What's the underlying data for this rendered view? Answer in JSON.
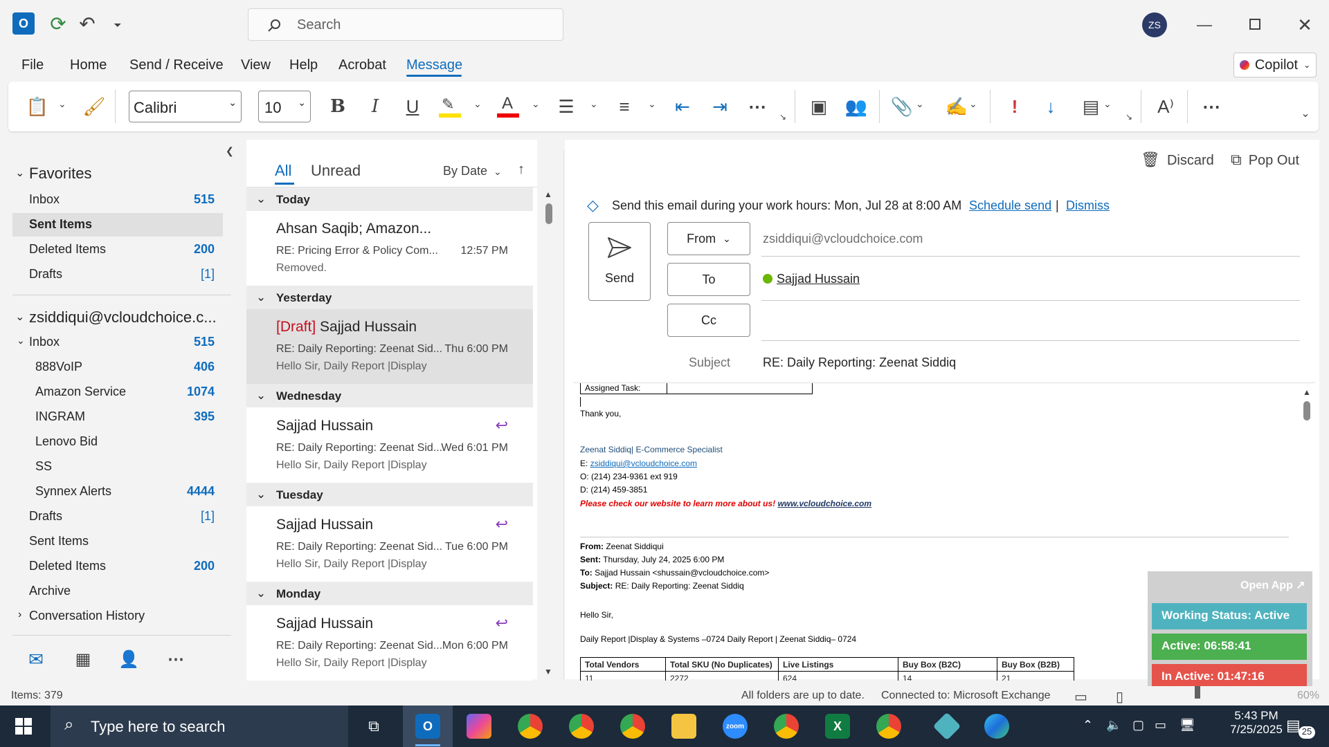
{
  "titlebar": {
    "search_placeholder": "Search",
    "avatar_initials": "ZS"
  },
  "menu": {
    "items": [
      "File",
      "Home",
      "Send / Receive",
      "View",
      "Help",
      "Acrobat",
      "Message"
    ],
    "copilot": "Copilot"
  },
  "ribbon": {
    "font_name": "Calibri",
    "font_size": "10"
  },
  "nav": {
    "favorites_label": "Favorites",
    "favorites": [
      {
        "label": "Inbox",
        "count": "515"
      },
      {
        "label": "Sent Items",
        "count": ""
      },
      {
        "label": "Deleted Items",
        "count": "200"
      },
      {
        "label": "Drafts",
        "count": "[1]"
      }
    ],
    "account": "zsiddiqui@vcloudchoice.c...",
    "inbox_label": "Inbox",
    "inbox_count": "515",
    "subfolders": [
      {
        "label": "888VoIP",
        "count": "406"
      },
      {
        "label": "Amazon Service",
        "count": "1074"
      },
      {
        "label": "INGRAM",
        "count": "395"
      },
      {
        "label": "Lenovo Bid",
        "count": ""
      },
      {
        "label": "SS",
        "count": ""
      },
      {
        "label": "Synnex Alerts",
        "count": "4444"
      }
    ],
    "folders": [
      {
        "label": "Drafts",
        "count": "[1]"
      },
      {
        "label": "Sent Items",
        "count": ""
      },
      {
        "label": "Deleted Items",
        "count": "200"
      },
      {
        "label": "Archive",
        "count": ""
      }
    ],
    "conversation_history": "Conversation History"
  },
  "list": {
    "tab_all": "All",
    "tab_unread": "Unread",
    "sort": "By Date",
    "groups": [
      "Today",
      "Yesterday",
      "Wednesday",
      "Tuesday",
      "Monday"
    ],
    "messages": [
      {
        "sender": "Ahsan Saqib; Amazon...",
        "subject": "RE: Pricing Error & Policy Com...",
        "time": "12:57 PM",
        "preview": "Removed."
      },
      {
        "draft": "[Draft]",
        "sender": "Sajjad Hussain",
        "subject": "RE: Daily Reporting: Zeenat Sid...",
        "time": "Thu 6:00 PM",
        "preview": "Hello Sir,  Daily Report |Display"
      },
      {
        "sender": "Sajjad Hussain",
        "subject": "RE: Daily Reporting: Zeenat Sid...",
        "time": "Wed 6:01 PM",
        "preview": "Hello Sir,  Daily Report |Display"
      },
      {
        "sender": "Sajjad Hussain",
        "subject": "RE: Daily Reporting: Zeenat Sid...",
        "time": "Tue 6:00 PM",
        "preview": "Hello Sir,  Daily Report |Display"
      },
      {
        "sender": "Sajjad Hussain",
        "subject": "RE: Daily Reporting: Zeenat Sid...",
        "time": "Mon 6:00 PM",
        "preview": "Hello Sir,  Daily Report |Display"
      }
    ]
  },
  "compose": {
    "discard": "Discard",
    "popout": "Pop Out",
    "info_text": "Send this email during your work hours: Mon, Jul 28 at 8:00 AM",
    "schedule_send": "Schedule send",
    "dismiss": "Dismiss",
    "pipe": "|",
    "send": "Send",
    "from": "From",
    "to": "To",
    "cc": "Cc",
    "from_value": "zsiddiqui@vcloudchoice.com",
    "to_value": "Sajjad Hussain",
    "subject_label": "Subject",
    "subject_value": "RE: Daily Reporting: Zeenat Siddiq"
  },
  "body": {
    "assigned_task": "Assigned Task:",
    "thanks": "Thank you,",
    "sig_name": "Zeenat Siddiq| E-Commerce Specialist",
    "sig_email_label": "E:",
    "sig_email": "zsiddiqui@vcloudchoice.com",
    "sig_office": "O: (214) 234-9361 ext 919",
    "sig_direct": "D: (214) 459-3851",
    "sig_promo": "Please check our website to learn more about us!",
    "sig_site": "www.vcloudchoice.com",
    "hdr_from_label": "From:",
    "hdr_from": "Zeenat Siddiqui",
    "hdr_sent_label": "Sent:",
    "hdr_sent": "Thursday, July 24, 2025 6:00 PM",
    "hdr_to_label": "To:",
    "hdr_to": "Sajjad Hussain <shussain@vcloudchoice.com>",
    "hdr_subject_label": "Subject:",
    "hdr_subject": "RE: Daily Reporting: Zeenat Siddiq",
    "greeting": "Hello Sir,",
    "report_line": "Daily Report |Display & Systems –0724 Daily Report | Zeenat Siddiq– 0724",
    "table_headers": [
      "Total Vendors",
      "Total SKU (No Duplicates)",
      "Live Listings",
      "Buy Box (B2C)",
      "Buy Box (B2B)"
    ],
    "table_row": [
      "11",
      "2272",
      "624",
      "14",
      "21"
    ]
  },
  "widget": {
    "open_app": "Open App ↗",
    "status": "Working Status: Active",
    "active": "Active: 06:58:41",
    "inactive": "In Active: 01:47:16"
  },
  "status": {
    "items": "Items: 379",
    "sync": "All folders are up to date.",
    "connected": "Connected to: Microsoft Exchange",
    "zoom": "60%"
  },
  "taskbar": {
    "search": "Type here to search",
    "time": "5:43 PM",
    "date": "7/25/2025",
    "notifications": "25"
  },
  "colors": {
    "accent": "#0f6cbd",
    "draft_red": "#c50f1f",
    "widget_teal": "#4fb3bf",
    "widget_green": "#4caf50",
    "widget_red": "#e5534b"
  }
}
